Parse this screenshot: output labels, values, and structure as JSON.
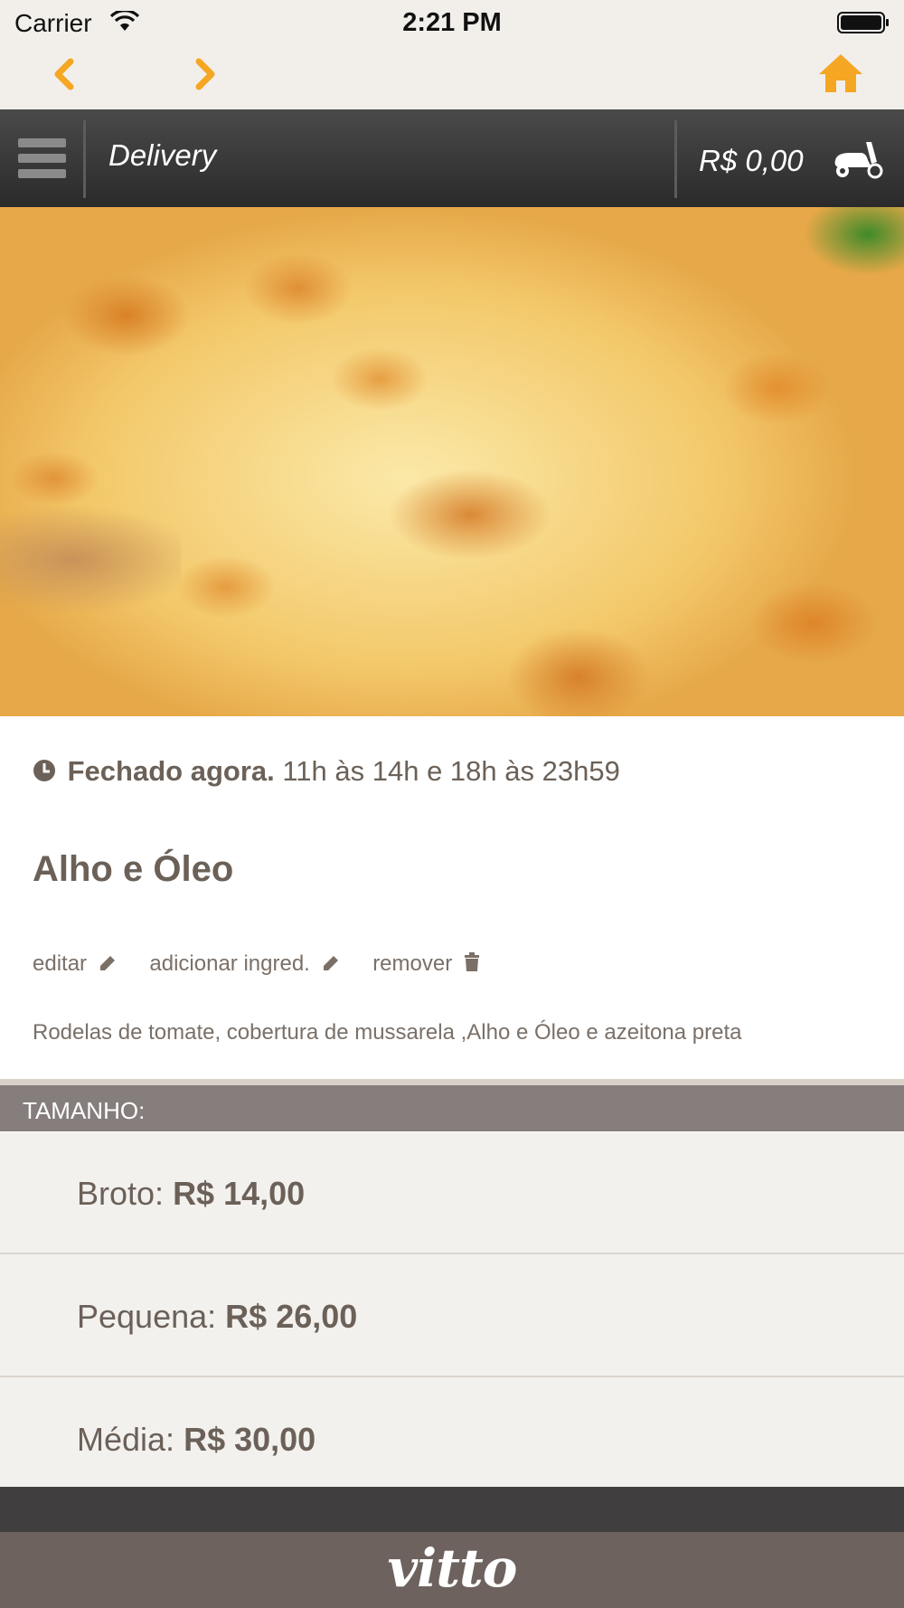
{
  "status_bar": {
    "carrier": "Carrier",
    "time": "2:21 PM"
  },
  "nav": {
    "back_icon": "chevron-left-icon",
    "forward_icon": "chevron-right-icon",
    "home_icon": "home-icon",
    "accent": "#f5a623"
  },
  "header": {
    "title": "Delivery",
    "cart_total": "R$ 0,00",
    "cart_icon": "scooter-icon",
    "menu_icon": "hamburger-icon"
  },
  "store": {
    "status": "Fechado agora.",
    "hours": "11h às 14h e 18h às 23h59"
  },
  "product": {
    "name": "Alho e Óleo",
    "actions": {
      "edit": "editar",
      "add_ingredient": "adicionar ingred.",
      "remove": "remover"
    },
    "description": "Rodelas de tomate, cobertura de mussarela ,Alho e Óleo e azeitona preta"
  },
  "sizes": {
    "header": "TAMANHO:",
    "items": [
      {
        "label": "Broto:",
        "price": "R$ 14,00"
      },
      {
        "label": "Pequena:",
        "price": "R$ 26,00"
      },
      {
        "label": "Média:",
        "price": "R$ 30,00"
      }
    ]
  },
  "footer": {
    "brand": "vitto"
  }
}
